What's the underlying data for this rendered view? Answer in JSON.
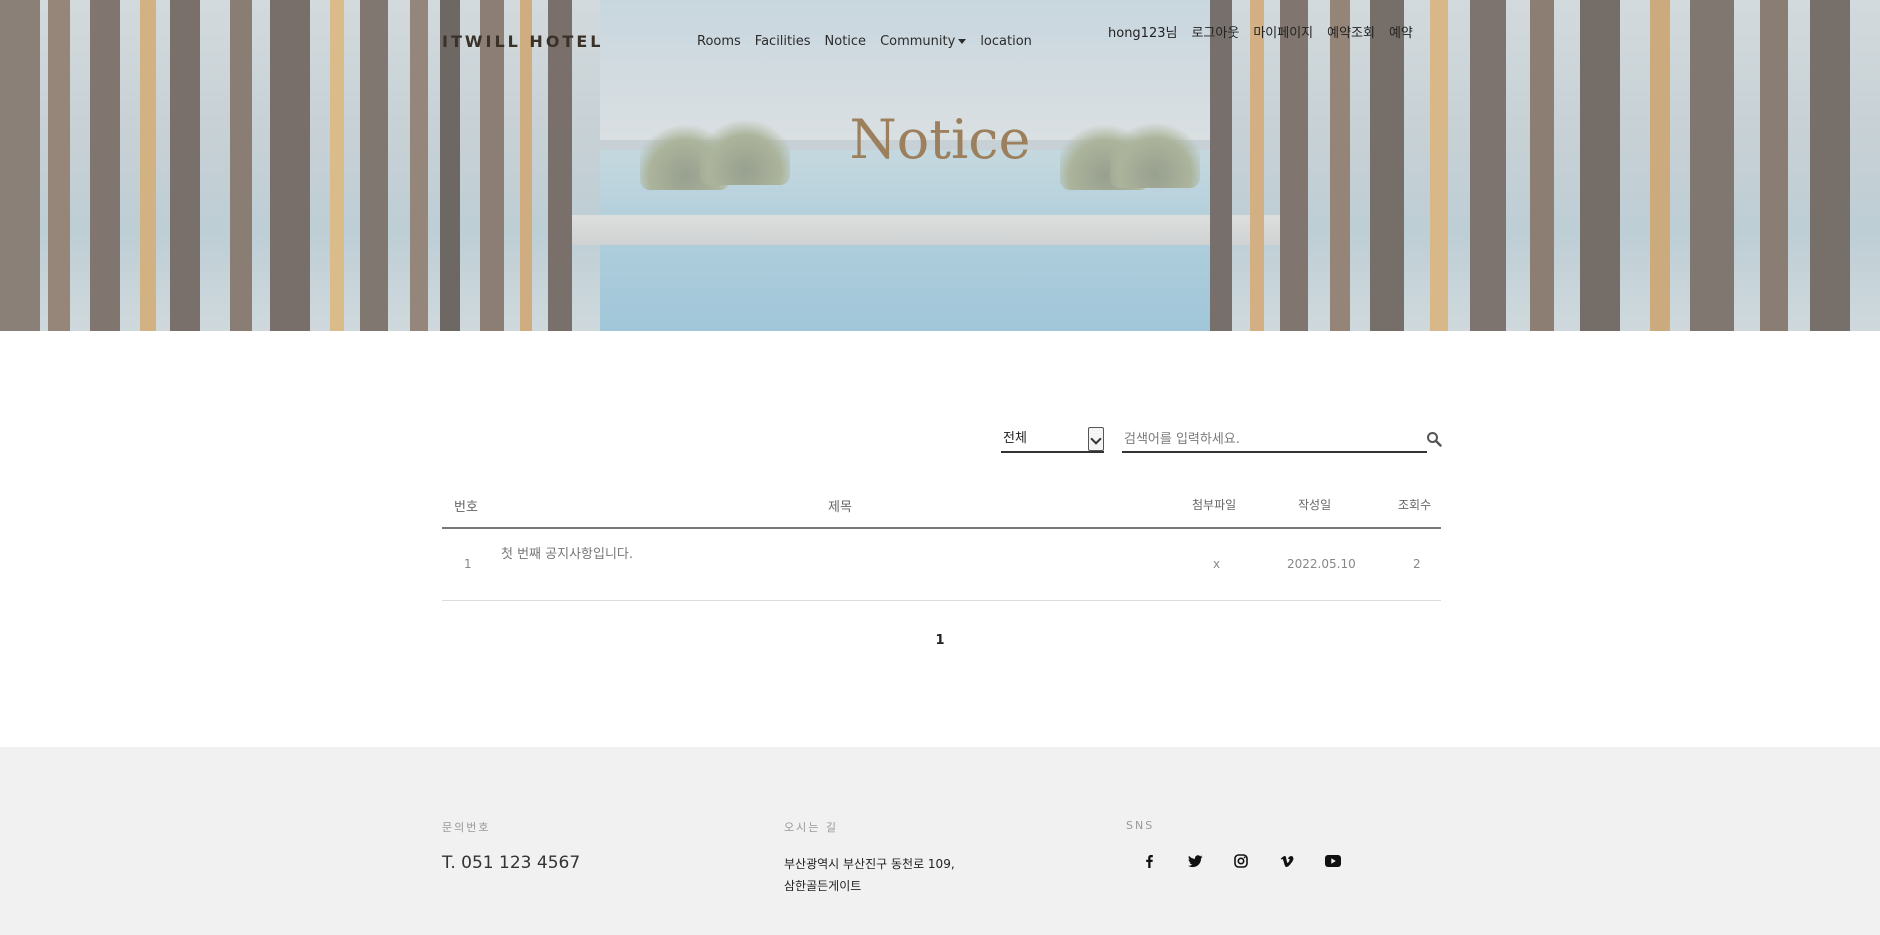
{
  "header": {
    "logo": "ITWILL HOTEL",
    "nav": [
      "Rooms",
      "Facilities",
      "Notice",
      "Community",
      "location"
    ],
    "user_greeting": "hong123님",
    "logout": "로그아웃",
    "mypage": "마이페이지",
    "reservation_check": "예약조회",
    "reservation": "예약"
  },
  "hero": {
    "title": "Notice"
  },
  "search": {
    "category_selected": "전체",
    "placeholder": "검색어를 입력하세요."
  },
  "table": {
    "columns": [
      "번호",
      "제목",
      "첨부파일",
      "작성일",
      "조회수"
    ],
    "rows": [
      {
        "no": "1",
        "title": "첫 번째 공지사항입니다.",
        "attachment": "x",
        "date": "2022.05.10",
        "views": "2"
      }
    ]
  },
  "pagination": {
    "current": "1"
  },
  "footer": {
    "contact_label": "문의번호",
    "phone": "T. 051 123 4567",
    "directions_label": "오시는 길",
    "address_line1": "부산광역시 부산진구 동천로 109,",
    "address_line2": "삼한골든게이트",
    "sns_label": "SNS",
    "sns_icons": [
      "facebook-icon",
      "twitter-icon",
      "instagram-icon",
      "vimeo-icon",
      "youtube-icon"
    ]
  },
  "colors": {
    "accent": "#9c7f5c",
    "footer_bg": "#f1f1f1"
  }
}
